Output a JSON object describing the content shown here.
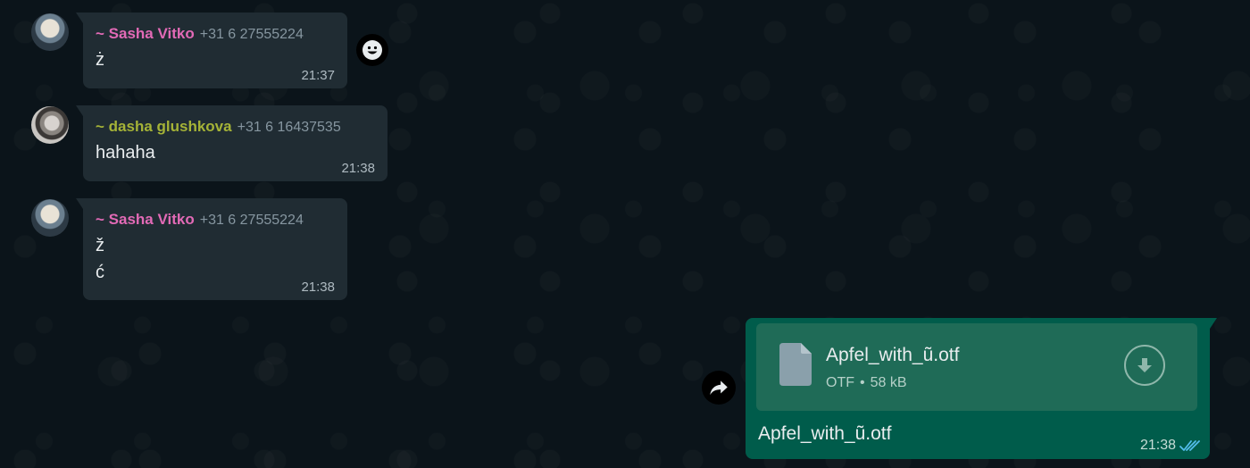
{
  "colors": {
    "background": "#0b141a",
    "bubble_incoming": "#202c33",
    "bubble_outgoing": "#005c4b",
    "sender_pink": "#e26ab6",
    "sender_olive": "#a5b337",
    "read_ticks": "#53bdeb"
  },
  "messages": [
    {
      "sender_name": "~ Sasha Vitko",
      "sender_phone": "+31 6 27555224",
      "sender_color": "#e26ab6",
      "lines": [
        "ż"
      ],
      "time": "21:37",
      "avatar_icon": "avatar-sasha",
      "reaction_icon": "smiley-icon"
    },
    {
      "sender_name": "~ dasha glushkova",
      "sender_phone": "+31 6 16437535",
      "sender_color": "#a5b337",
      "lines": [
        "hahaha"
      ],
      "time": "21:38",
      "avatar_icon": "avatar-dasha"
    },
    {
      "sender_name": "~ Sasha Vitko",
      "sender_phone": "+31 6 27555224",
      "sender_color": "#e26ab6",
      "lines": [
        "ž",
        "ć"
      ],
      "time": "21:38",
      "avatar_icon": "avatar-sasha"
    }
  ],
  "outgoing": {
    "file_name": "Apfel_with_ũ.otf",
    "file_type": "OTF",
    "file_size": "58 kB",
    "separator": "•",
    "caption": "Apfel_with_ũ.otf",
    "time": "21:38",
    "status_icon": "double-check-icon",
    "download_icon": "download-icon",
    "forward_icon": "forward-icon"
  }
}
